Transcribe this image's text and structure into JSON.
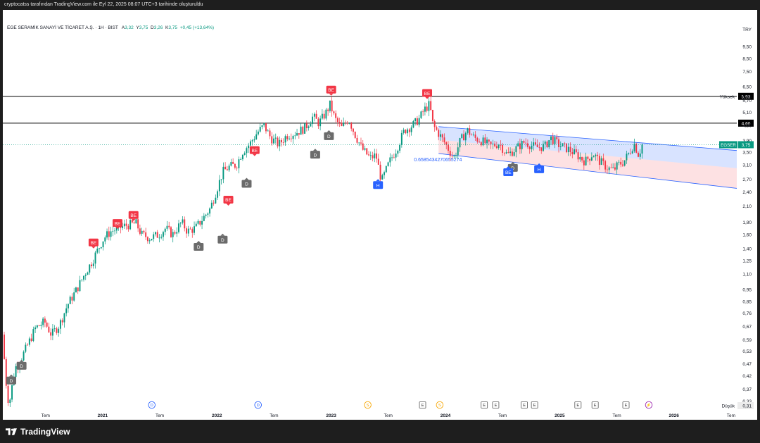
{
  "header_text": "cryptocatss tarafından TradingView.com ile Eyl 22, 2025 08:07 UTC+3 tarihinde oluşturuldu",
  "brand": "TradingView",
  "legend": {
    "symbol_name": "EGE SERAMİK SANAYİ VE TİCARET A.Ş. · 1H · BIST",
    "open_label": "A",
    "open": "3,32",
    "high_label": "Y",
    "high": "3,75",
    "low_label": "D",
    "low": "3,26",
    "close_label": "K",
    "close": "3,75",
    "change": "+0,45 (+13,64%)"
  },
  "chart_data": {
    "type": "candlestick",
    "currency": "TRY",
    "y_scale": "log",
    "y_range": [
      0.3,
      10.5
    ],
    "y_ticks": [
      "9,50",
      "8,50",
      "7,50",
      "6,50",
      "5,70",
      "5,10",
      "4,50",
      "3,90",
      "3,50",
      "3,10",
      "2,70",
      "2,40",
      "2,10",
      "1,80",
      "1,60",
      "1,40",
      "1,25",
      "1,10",
      "0,95",
      "0,85",
      "0,76",
      "0,67",
      "0,59",
      "0,53",
      "0,47",
      "0,42",
      "0,37",
      "0,33"
    ],
    "x_ticks": [
      {
        "label": "Tem",
        "t": 2020.5,
        "bold": false
      },
      {
        "label": "2021",
        "t": 2021.0,
        "bold": true
      },
      {
        "label": "Tem",
        "t": 2021.5,
        "bold": false
      },
      {
        "label": "2022",
        "t": 2022.0,
        "bold": true
      },
      {
        "label": "Tem",
        "t": 2022.5,
        "bold": false
      },
      {
        "label": "2023",
        "t": 2023.0,
        "bold": true
      },
      {
        "label": "Tem",
        "t": 2023.5,
        "bold": false
      },
      {
        "label": "2024",
        "t": 2024.0,
        "bold": true
      },
      {
        "label": "Tem",
        "t": 2024.5,
        "bold": false
      },
      {
        "label": "2025",
        "t": 2025.0,
        "bold": true
      },
      {
        "label": "Tem",
        "t": 2025.5,
        "bold": false
      },
      {
        "label": "2026",
        "t": 2026.0,
        "bold": true
      },
      {
        "label": "Tem",
        "t": 2026.5,
        "bold": false
      }
    ],
    "price_path": [
      [
        2020.13,
        0.62
      ],
      [
        2020.17,
        0.36
      ],
      [
        2020.19,
        0.32
      ],
      [
        2020.24,
        0.45
      ],
      [
        2020.3,
        0.5
      ],
      [
        2020.35,
        0.56
      ],
      [
        2020.42,
        0.66
      ],
      [
        2020.5,
        0.7
      ],
      [
        2020.56,
        0.62
      ],
      [
        2020.63,
        0.68
      ],
      [
        2020.7,
        0.82
      ],
      [
        2020.78,
        0.95
      ],
      [
        2020.85,
        1.1
      ],
      [
        2020.92,
        1.25
      ],
      [
        2020.97,
        1.4
      ],
      [
        2021.02,
        1.55
      ],
      [
        2021.08,
        1.65
      ],
      [
        2021.15,
        1.7
      ],
      [
        2021.22,
        1.75
      ],
      [
        2021.3,
        1.78
      ],
      [
        2021.35,
        1.6
      ],
      [
        2021.42,
        1.55
      ],
      [
        2021.5,
        1.6
      ],
      [
        2021.56,
        1.7
      ],
      [
        2021.62,
        1.6
      ],
      [
        2021.7,
        1.8
      ],
      [
        2021.75,
        1.65
      ],
      [
        2021.82,
        1.7
      ],
      [
        2021.88,
        1.85
      ],
      [
        2021.95,
        2.05
      ],
      [
        2022.0,
        2.4
      ],
      [
        2022.06,
        2.9
      ],
      [
        2022.12,
        3.05
      ],
      [
        2022.18,
        3.1
      ],
      [
        2022.23,
        3.5
      ],
      [
        2022.3,
        3.8
      ],
      [
        2022.36,
        4.2
      ],
      [
        2022.42,
        4.5
      ],
      [
        2022.48,
        4.0
      ],
      [
        2022.55,
        3.75
      ],
      [
        2022.62,
        4.1
      ],
      [
        2022.7,
        4.2
      ],
      [
        2022.78,
        4.4
      ],
      [
        2022.85,
        4.9
      ],
      [
        2022.9,
        4.6
      ],
      [
        2022.96,
        5.05
      ],
      [
        2023.0,
        5.5
      ],
      [
        2023.04,
        4.8
      ],
      [
        2023.1,
        4.4
      ],
      [
        2023.16,
        4.8
      ],
      [
        2023.22,
        4.1
      ],
      [
        2023.28,
        3.6
      ],
      [
        2023.35,
        3.3
      ],
      [
        2023.4,
        3.4
      ],
      [
        2023.45,
        2.65
      ],
      [
        2023.52,
        3.2
      ],
      [
        2023.58,
        3.6
      ],
      [
        2023.65,
        4.3
      ],
      [
        2023.72,
        4.5
      ],
      [
        2023.78,
        4.8
      ],
      [
        2023.82,
        5.2
      ],
      [
        2023.87,
        5.5
      ],
      [
        2023.9,
        4.5
      ],
      [
        2023.96,
        4.1
      ],
      [
        2024.02,
        3.7
      ],
      [
        2024.08,
        3.3
      ],
      [
        2024.14,
        3.9
      ],
      [
        2024.2,
        4.3
      ],
      [
        2024.26,
        4.0
      ],
      [
        2024.32,
        3.9
      ],
      [
        2024.4,
        3.7
      ],
      [
        2024.48,
        3.8
      ],
      [
        2024.55,
        3.4
      ],
      [
        2024.62,
        3.6
      ],
      [
        2024.7,
        3.85
      ],
      [
        2024.8,
        3.65
      ],
      [
        2024.88,
        3.7
      ],
      [
        2024.93,
        4.0
      ],
      [
        2025.0,
        3.75
      ],
      [
        2025.08,
        3.6
      ],
      [
        2025.16,
        3.4
      ],
      [
        2025.23,
        3.2
      ],
      [
        2025.3,
        3.45
      ],
      [
        2025.36,
        3.2
      ],
      [
        2025.43,
        3.0
      ],
      [
        2025.48,
        2.95
      ],
      [
        2025.52,
        3.1
      ],
      [
        2025.57,
        3.2
      ],
      [
        2025.62,
        3.5
      ],
      [
        2025.66,
        3.8
      ],
      [
        2025.7,
        3.4
      ],
      [
        2025.73,
        3.75
      ]
    ],
    "horizontal_levels": [
      {
        "value": 5.93,
        "label": "5,93"
      },
      {
        "value": 4.6,
        "label": "4,60"
      }
    ],
    "channel": {
      "upper": [
        [
          2023.94,
          4.45
        ],
        [
          2026.55,
          3.55
        ]
      ],
      "mid": [
        [
          2023.94,
          3.93
        ],
        [
          2026.55,
          3.0
        ]
      ],
      "lower": [
        [
          2023.94,
          3.45
        ],
        [
          2026.55,
          2.48
        ]
      ],
      "annotation": "0.6585434270655274"
    },
    "signals": [
      {
        "type": "sell",
        "label": "BE",
        "t": 2020.92,
        "price": 1.48
      },
      {
        "type": "sell",
        "label": "BE",
        "t": 2021.13,
        "price": 1.78
      },
      {
        "type": "sell",
        "label": "BE",
        "t": 2021.27,
        "price": 1.92
      },
      {
        "type": "sell",
        "label": "BE",
        "t": 2022.1,
        "price": 2.22
      },
      {
        "type": "sell",
        "label": "BE",
        "t": 2022.33,
        "price": 3.55
      },
      {
        "type": "sell",
        "label": "BE",
        "t": 2023.0,
        "price": 6.3
      },
      {
        "type": "sell",
        "label": "BE",
        "t": 2023.84,
        "price": 6.1
      },
      {
        "type": "neutral",
        "label": "D",
        "t": 2020.2,
        "price": 0.4
      },
      {
        "type": "neutral",
        "label": "D",
        "t": 2020.29,
        "price": 0.46
      },
      {
        "type": "neutral",
        "label": "D",
        "t": 2021.84,
        "price": 1.42
      },
      {
        "type": "neutral",
        "label": "D",
        "t": 2022.05,
        "price": 1.52
      },
      {
        "type": "neutral",
        "label": "D",
        "t": 2022.26,
        "price": 2.58
      },
      {
        "type": "neutral",
        "label": "D",
        "t": 2022.86,
        "price": 3.4
      },
      {
        "type": "neutral",
        "label": "D",
        "t": 2022.98,
        "price": 4.05
      },
      {
        "type": "neutral",
        "label": "D",
        "t": 2024.59,
        "price": 3.0
      },
      {
        "type": "buy",
        "label": "BE",
        "t": 2024.55,
        "price": 2.88
      },
      {
        "type": "buy",
        "label": "H",
        "t": 2023.41,
        "price": 2.55
      },
      {
        "type": "buy",
        "label": "H",
        "t": 2024.82,
        "price": 2.96
      }
    ],
    "events": [
      {
        "label": "D",
        "kind": "div",
        "t": 2021.43
      },
      {
        "label": "D",
        "kind": "div",
        "t": 2022.36
      },
      {
        "label": "S",
        "kind": "split",
        "t": 2023.32
      },
      {
        "label": "E",
        "kind": "earn",
        "t": 2023.8
      },
      {
        "label": "S",
        "kind": "split",
        "t": 2023.95
      },
      {
        "label": "E",
        "kind": "earn",
        "t": 2024.34
      },
      {
        "label": "E",
        "kind": "earn",
        "t": 2024.44
      },
      {
        "label": "E",
        "kind": "earn",
        "t": 2024.69
      },
      {
        "label": "E",
        "kind": "earn",
        "t": 2024.78
      },
      {
        "label": "E",
        "kind": "earn",
        "t": 2025.16
      },
      {
        "label": "E",
        "kind": "earn",
        "t": 2025.31
      },
      {
        "label": "E",
        "kind": "earn",
        "t": 2025.58
      },
      {
        "label": "⚡",
        "kind": "news",
        "t": 2025.78
      }
    ],
    "price_tags": {
      "high_label": "Yüksek",
      "high_value": "5,93",
      "low_label": "Düşük",
      "low_value": "0,31",
      "symbol": "EGSER",
      "last": "3,75"
    },
    "colors": {
      "up": "#089981",
      "down": "#f23645",
      "channel_blue": "#2962ff",
      "channel_red": "#f23645"
    }
  }
}
